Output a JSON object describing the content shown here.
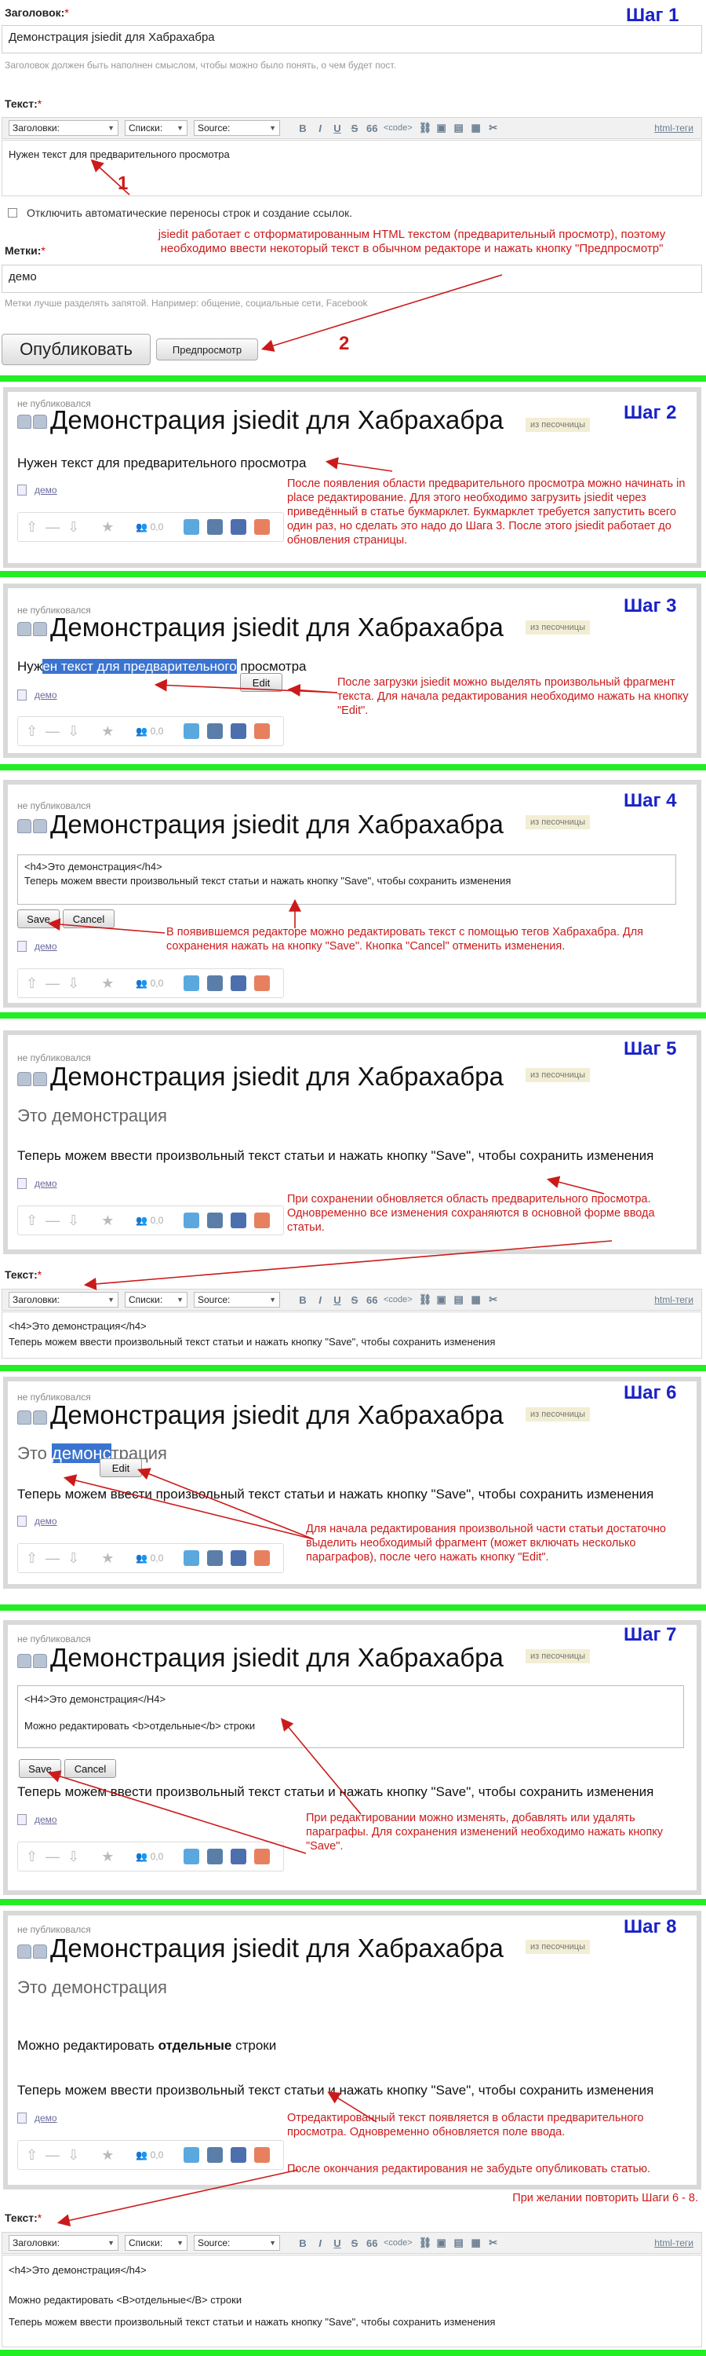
{
  "colors": {
    "step": "#1a22c8",
    "annotation": "#cc1a1a",
    "separator": "#22ee22",
    "badge": "#f2eed4"
  },
  "form": {
    "title_label": "Заголовок:",
    "title_value": "Демонстрация jsiedit для Хабрахабра",
    "title_hint": "Заголовок должен быть наполнен смыслом, чтобы можно было понять, о чем будет пост.",
    "text_label": "Текст:",
    "tags_label": "Метки:",
    "tags_value": "демо",
    "tags_hint": "Метки лучше разделять запятой. Например: общение, социальные сети, Facebook",
    "checkbox_label": "Отключить автоматические переносы строк и создание ссылок.",
    "publish_button": "Опубликовать",
    "preview_button": "Предпросмотр"
  },
  "toolbar": {
    "headings": "Заголовки:",
    "lists": "Списки:",
    "source": "Source:",
    "bold": "B",
    "italic": "I",
    "underline": "U",
    "strike": "S",
    "quote": "66",
    "code": "<code>",
    "html_tags": "html-теги"
  },
  "steps": [
    "Шаг 1",
    "Шаг 2",
    "Шаг 3",
    "Шаг 4",
    "Шаг 5",
    "Шаг 6",
    "Шаг 7",
    "Шаг 8"
  ],
  "numbers": {
    "n1": "1",
    "n2": "2"
  },
  "post": {
    "status": "не публиковался",
    "title": "Демонстрация jsiedit для Хабрахабра",
    "badge": "из песочницы",
    "tag": "демо",
    "score": "0,0"
  },
  "texts": {
    "preview": "Нужен текст для предварительного просмотра",
    "s3_before": "Нуж",
    "s3_sel": "ен текст для предварительного",
    "s3_after": " просмотра",
    "edit_button": "Edit",
    "h4_code": "<h4>Это демонстрация</h4>",
    "body_code": "Теперь можем ввести произвольный текст статьи и нажать кнопку \"Save\", чтобы сохранить изменения",
    "save": "Save",
    "cancel": "Cancel",
    "heading": "Это демонстрация",
    "body": "Теперь можем ввести произвольный текст статьи и нажать кнопку \"Save\", чтобы сохранить изменения",
    "s6_before": "Это ",
    "s6_sel": "демонс",
    "s6_after": "трация",
    "s7_h4": "<H4>Это демонстрация</H4>",
    "s7_line": "Можно редактировать <b>отдельные</b> строки",
    "s8_line_a": "Можно редактировать ",
    "s8_line_b": "отдельные",
    "s8_line_c": " строки",
    "s8_code_line": "Можно редактировать <B>отдельные</B> строки"
  },
  "annotations": {
    "a1": "jsiedit работает с отформатированным HTML текстом (предварительный просмотр), поэтому необходимо ввести некоторый текст в обычном редакторе и нажать кнопку \"Предпросмотр\"",
    "a2": "После появления области предварительного просмотра можно начинать in place редактирование. Для этого необходимо загрузить jsiedit через приведённый в статье букмарклет. Букмарклет требуется запустить всего один раз, но сделать это надо до Шага 3. После этого jsiedit работает до обновления страницы.",
    "a3": "После загрузки jsiedit можно выделять произвольный фрагмент текста. Для начала редактирования необходимо нажать на кнопку \"Edit\".",
    "a4": "В появившемся редакторе можно редактировать текст с помощью тегов Хабрахабра. Для сохранения нажать на кнопку \"Save\". Кнопка \"Cancel\" отменить изменения.",
    "a5": "При сохранении обновляется область предварительного просмотра. Одновременно все изменения сохраняются в основной форме ввода статьи.",
    "a6": "Для начала редактирования произвольной части статьи достаточно выделить необходимый фрагмент (может включать несколько параграфов), после чего нажать кнопку \"Edit\".",
    "a7": "При редактировании можно изменять, добавлять или удалять параграфы. Для сохранения изменений необходимо нажать кнопку \"Save\".",
    "a8": "Отредактированный текст появляется в области предварительного просмотра. Одновременно обновляется поле ввода.",
    "a8b": "После окончания редактирования не забудьте опубликовать статью.",
    "repeat": "При желании повторить Шаги 6 - 8."
  }
}
